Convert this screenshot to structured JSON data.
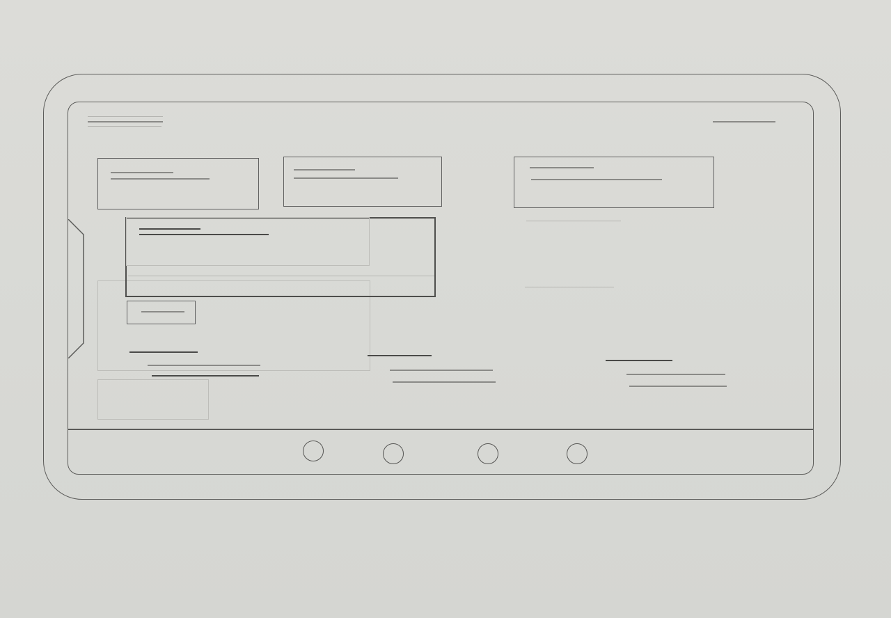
{
  "sketch": {
    "kind": "hand-drawn tablet wireframe",
    "texts": []
  },
  "colors": {
    "paper": "#d9dad6",
    "pencil": "#5c5c5a",
    "pencil_light": "#b4b4b0"
  },
  "bottom_nav": {
    "buttons": [
      "nav-button-1",
      "nav-button-2",
      "nav-button-3",
      "nav-button-4"
    ]
  }
}
